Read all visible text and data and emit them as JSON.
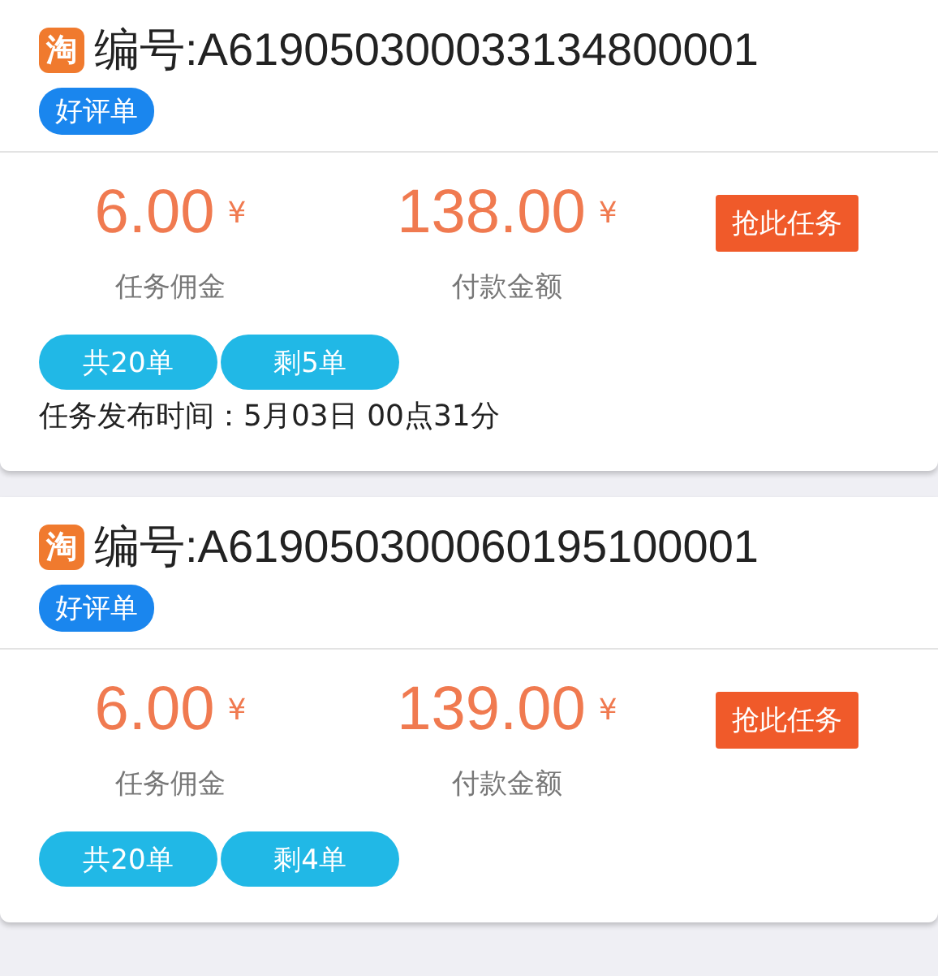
{
  "tasks": [
    {
      "logo": "淘",
      "number": "编号:A619050300033134800001",
      "tag": "好评单",
      "commission": "6.00",
      "commission_currency": "¥",
      "commission_label": "任务佣金",
      "payment": "138.00",
      "payment_currency": "¥",
      "payment_label": "付款金额",
      "action": "抢此任务",
      "chips": [
        "共20单",
        "剩5单"
      ],
      "publish_time": "任务发布时间：5月03日 00点31分"
    },
    {
      "logo": "淘",
      "number": "编号:A619050300060195100001",
      "tag": "好评单",
      "commission": "6.00",
      "commission_currency": "¥",
      "commission_label": "任务佣金",
      "payment": "139.00",
      "payment_currency": "¥",
      "payment_label": "付款金额",
      "action": "抢此任务",
      "chips": [
        "共20单",
        "剩4单"
      ]
    }
  ]
}
